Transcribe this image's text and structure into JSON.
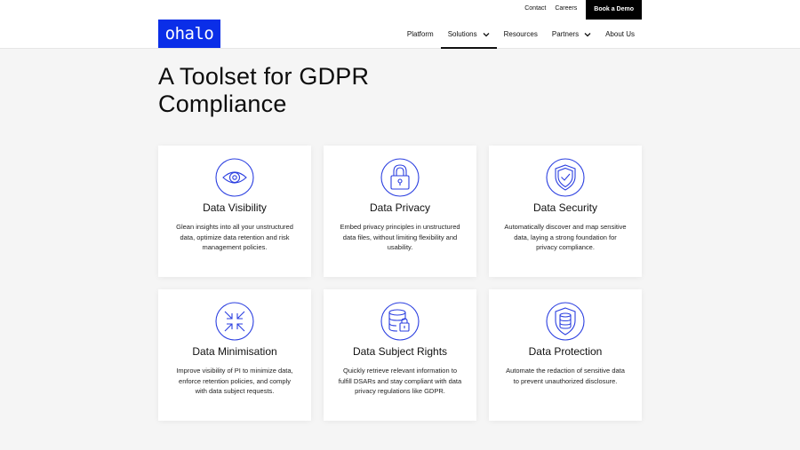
{
  "header": {
    "logo_text": "ohalo",
    "util_links": [
      "Contact",
      "Careers"
    ],
    "demo_label": "Book a Demo",
    "nav": [
      "Platform",
      "Solutions",
      "Resources",
      "Partners",
      "About Us"
    ]
  },
  "page": {
    "title_line1": "A Toolset for GDPR",
    "title_line2": "Compliance"
  },
  "cards": [
    {
      "title": "Data Visibility",
      "desc": "Glean insights into all your unstructured data, optimize data retention and risk management policies.",
      "icon": "eye-icon"
    },
    {
      "title": "Data Privacy",
      "desc": "Embed privacy principles in unstructured data files, without limiting flexibility and usability.",
      "icon": "padlock-icon"
    },
    {
      "title": "Data Security",
      "desc": "Automatically discover and map sensitive data, laying a strong foundation for privacy compliance.",
      "icon": "shield-check-icon"
    },
    {
      "title": "Data Minimisation",
      "desc": "Improve visibility of PI to minimize data, enforce retention policies, and comply with data subject requests.",
      "icon": "compress-arrows-icon"
    },
    {
      "title": "Data Subject Rights",
      "desc": "Quickly retrieve relevant information to fulfill DSARs and stay compliant with data privacy regulations like GDPR.",
      "icon": "database-lock-icon"
    },
    {
      "title": "Data Protection",
      "desc": "Automate the redaction of sensitive data to prevent unauthorized disclosure.",
      "icon": "shield-database-icon"
    }
  ],
  "colors": {
    "brand": "#0a2ee8",
    "icon_stroke": "#2b3fe0",
    "background": "#f5f5f5"
  }
}
